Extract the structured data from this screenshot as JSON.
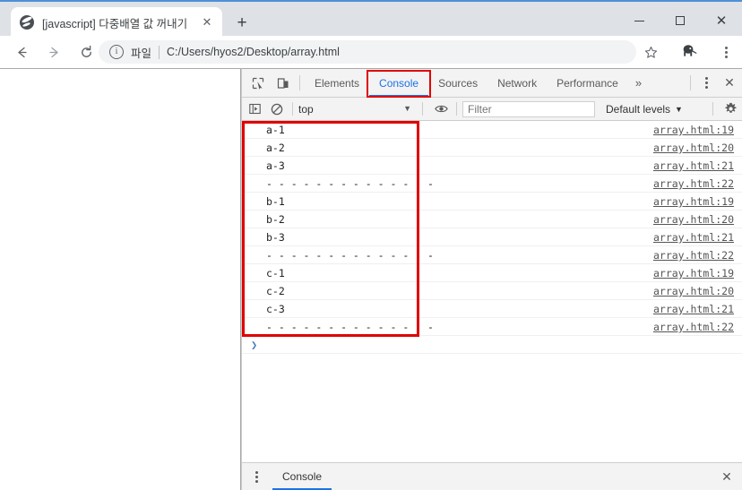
{
  "browser": {
    "tab": {
      "title": "[javascript] 다중배열 값 꺼내기",
      "favicon": "globe-icon",
      "close_label": "✕"
    },
    "new_tab_label": "+",
    "window_controls": {
      "minimize": "minimize-icon",
      "maximize": "maximize-icon",
      "close": "close-icon"
    },
    "nav": {
      "back": "←",
      "forward": "→",
      "reload": "⟳"
    },
    "omnibox": {
      "info_icon": "ⓘ",
      "scheme_label": "파일",
      "url": "C:/Users/hyos2/Desktop/array.html",
      "bookmark_icon": "star-icon",
      "extension_icon": "extension-icon",
      "menu_icon": "three-dot-menu-icon"
    }
  },
  "devtools": {
    "toolbar_icons": {
      "inspect": "inspect-element-icon",
      "device": "device-toolbar-icon"
    },
    "tabs": [
      {
        "label": "Elements",
        "active": false
      },
      {
        "label": "Console",
        "active": true
      },
      {
        "label": "Sources",
        "active": false
      },
      {
        "label": "Network",
        "active": false
      },
      {
        "label": "Performance",
        "active": false
      }
    ],
    "more_tabs_label": "»",
    "kebab_label": "more-options-icon",
    "close_label": "✕",
    "filterbar": {
      "sidebar_toggle": "console-sidebar-icon",
      "clear_label": "clear-console-icon",
      "context": "top",
      "context_caret": "▼",
      "eye_icon": "live-expression-icon",
      "filter_placeholder": "Filter",
      "filter_value": "",
      "levels_label": "Default levels",
      "levels_caret": "▼",
      "settings_icon": "gear-icon"
    },
    "logs": [
      {
        "message": "a-1",
        "source": "array.html:19"
      },
      {
        "message": "a-2",
        "source": "array.html:20"
      },
      {
        "message": "a-3",
        "source": "array.html:21"
      },
      {
        "message": "- - - - - - - - - - - - - -",
        "source": "array.html:22"
      },
      {
        "message": "b-1",
        "source": "array.html:19"
      },
      {
        "message": "b-2",
        "source": "array.html:20"
      },
      {
        "message": "b-3",
        "source": "array.html:21"
      },
      {
        "message": "- - - - - - - - - - - - - -",
        "source": "array.html:22"
      },
      {
        "message": "c-1",
        "source": "array.html:19"
      },
      {
        "message": "c-2",
        "source": "array.html:20"
      },
      {
        "message": "c-3",
        "source": "array.html:21"
      },
      {
        "message": "- - - - - - - - - - - - - -",
        "source": "array.html:22"
      }
    ],
    "prompt_caret": "❯",
    "prompt_value": "",
    "drawer": {
      "kebab": "drawer-more-icon",
      "tab_label": "Console",
      "close_label": "✕"
    }
  },
  "annotations": {
    "highlight_color": "#e00000",
    "boxes": [
      "console-tab",
      "console-log-output"
    ]
  }
}
